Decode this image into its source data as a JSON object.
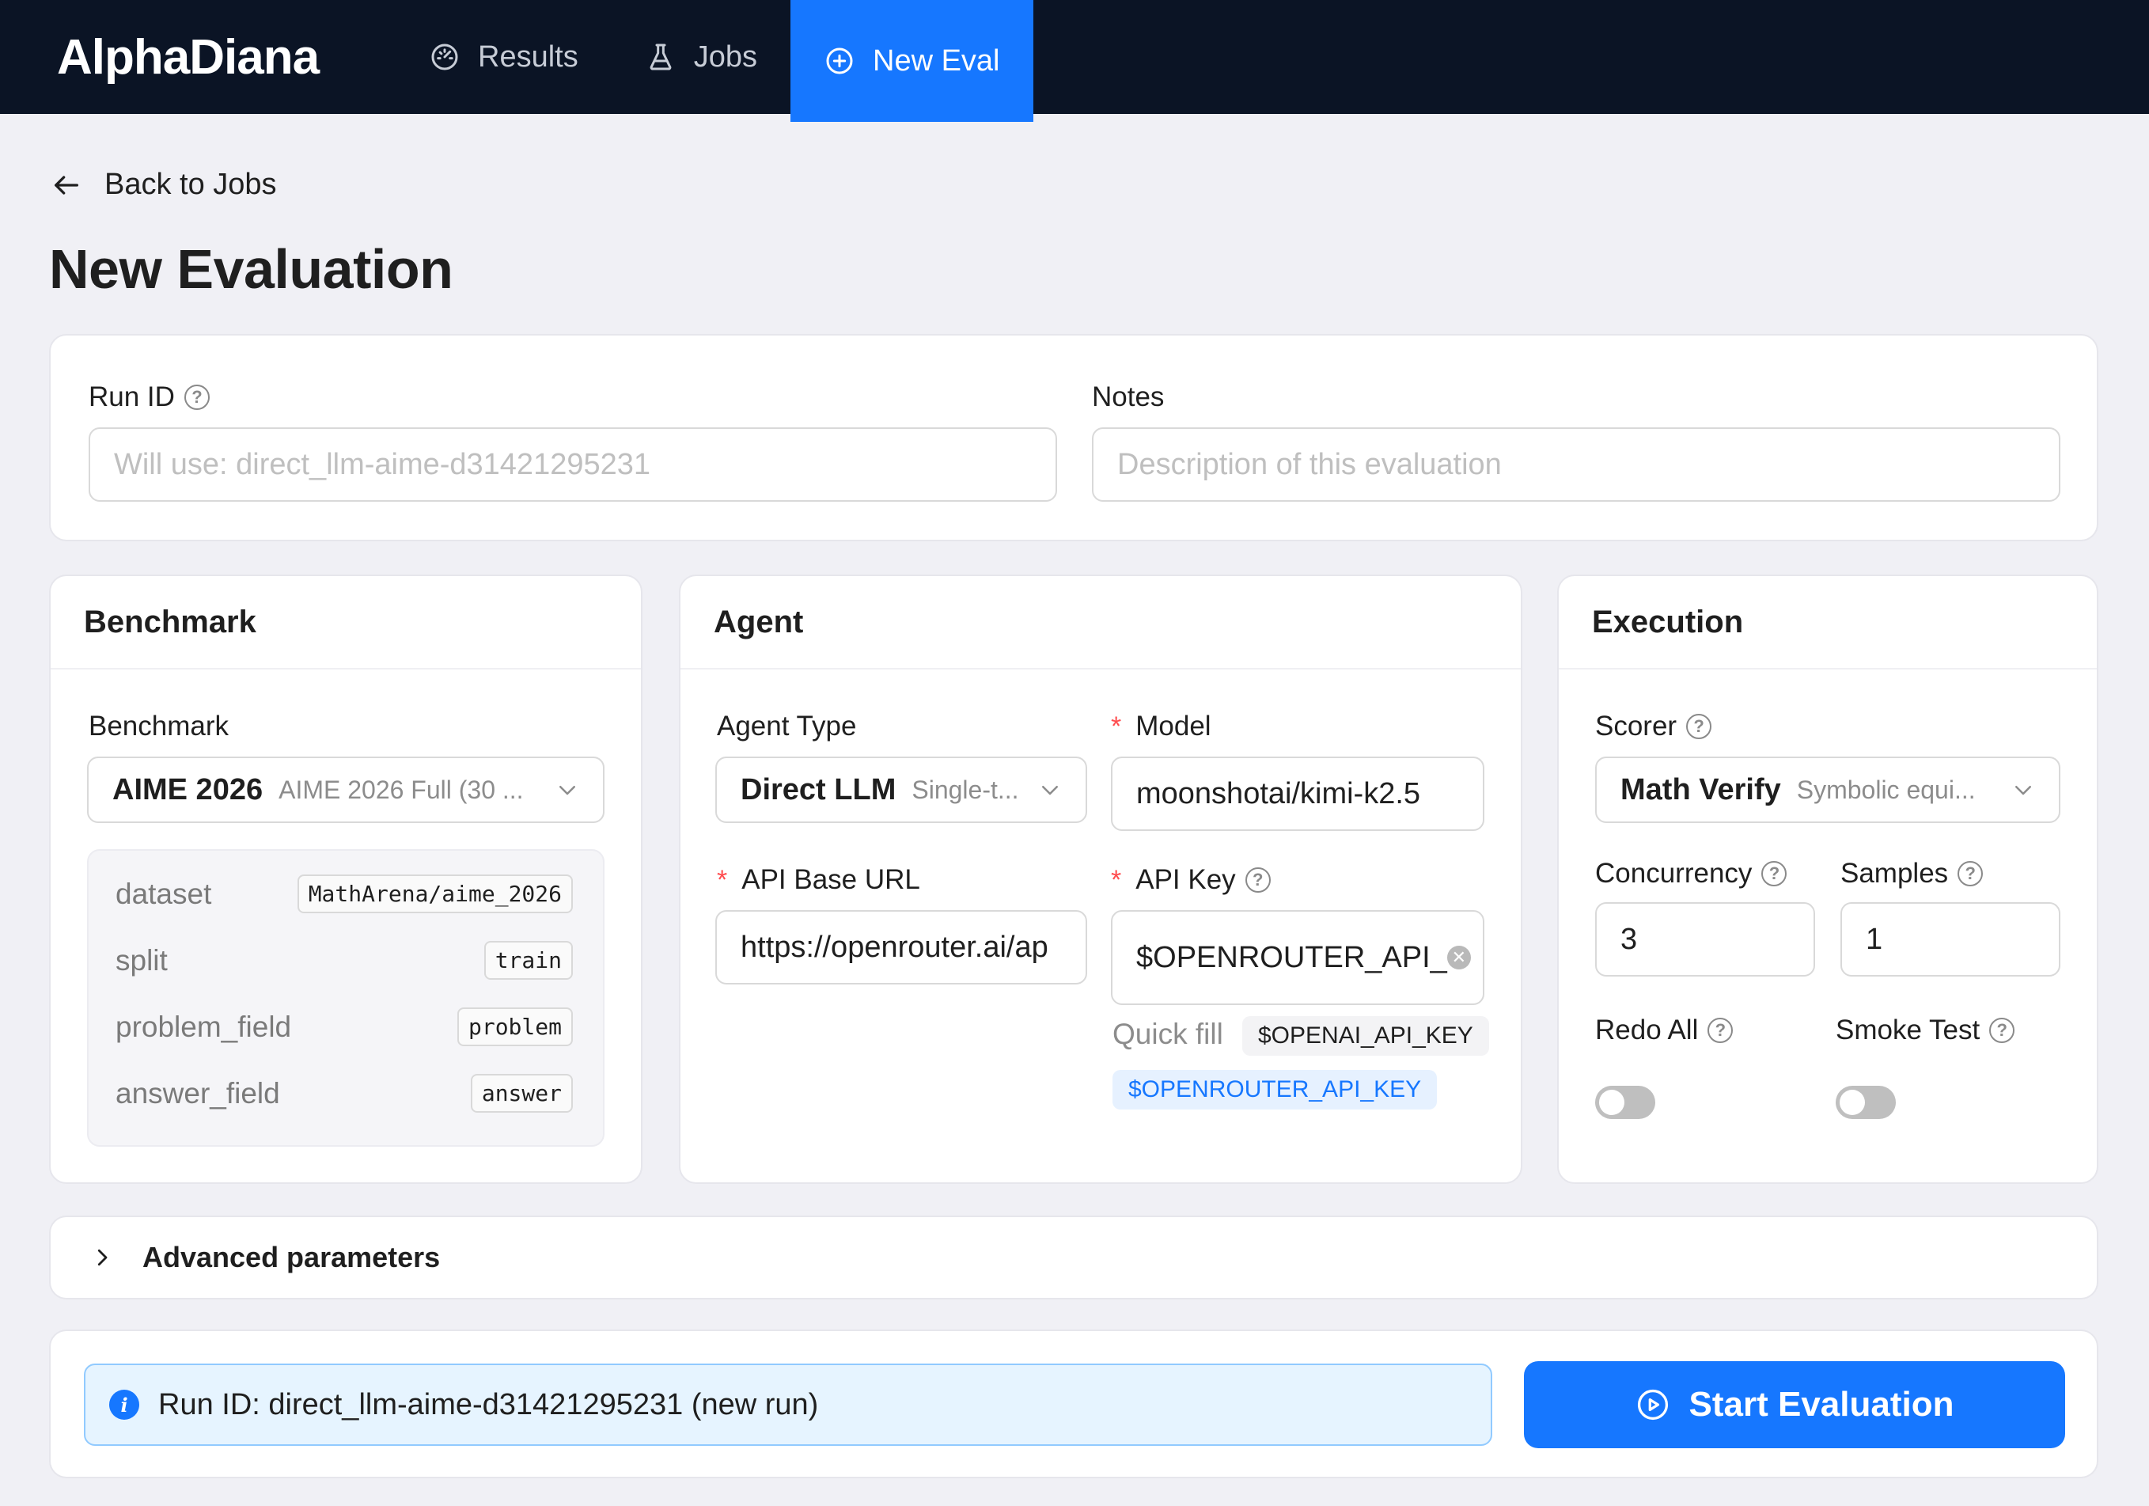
{
  "header": {
    "brand": "AlphaDiana",
    "nav": [
      {
        "label": "Results",
        "icon": "dashboard-icon"
      },
      {
        "label": "Jobs",
        "icon": "flask-icon"
      },
      {
        "label": "New Eval",
        "icon": "plus-circle-icon",
        "active": true
      }
    ]
  },
  "page": {
    "back_label": "Back to Jobs",
    "title": "New Evaluation"
  },
  "run": {
    "run_id_label": "Run ID",
    "run_id_placeholder": "Will use: direct_llm-aime-d31421295231",
    "notes_label": "Notes",
    "notes_placeholder": "Description of this evaluation"
  },
  "benchmark": {
    "title": "Benchmark",
    "field_label": "Benchmark",
    "selected": "AIME 2026",
    "selected_desc": "AIME 2026 Full (30 ...",
    "details": [
      {
        "key": "dataset",
        "value": "MathArena/aime_2026"
      },
      {
        "key": "split",
        "value": "train"
      },
      {
        "key": "problem_field",
        "value": "problem"
      },
      {
        "key": "answer_field",
        "value": "answer"
      }
    ]
  },
  "agent": {
    "title": "Agent",
    "type_label": "Agent Type",
    "type_value": "Direct LLM",
    "type_desc": "Single-t...",
    "model_label": "Model",
    "model_value": "moonshotai/kimi-k2.5",
    "base_url_label": "API Base URL",
    "base_url_value": "https://openrouter.ai/ap",
    "api_key_label": "API Key",
    "api_key_value": "$OPENROUTER_API_",
    "quick_fill_label": "Quick fill",
    "quick_fill": [
      "$OPENAI_API_KEY",
      "$OPENROUTER_API_KEY"
    ]
  },
  "execution": {
    "title": "Execution",
    "scorer_label": "Scorer",
    "scorer_value": "Math Verify",
    "scorer_desc": "Symbolic equi...",
    "concurrency_label": "Concurrency",
    "concurrency_value": "3",
    "samples_label": "Samples",
    "samples_value": "1",
    "redo_label": "Redo All",
    "redo_on": false,
    "smoke_label": "Smoke Test",
    "smoke_on": false
  },
  "advanced": {
    "label": "Advanced parameters"
  },
  "footer": {
    "alert_text": "Run ID: direct_llm-aime-d31421295231 (new run)",
    "start_label": "Start Evaluation"
  },
  "colors": {
    "accent": "#1677ff",
    "header_bg": "#0b1425",
    "page_bg": "#f0f0f5"
  }
}
